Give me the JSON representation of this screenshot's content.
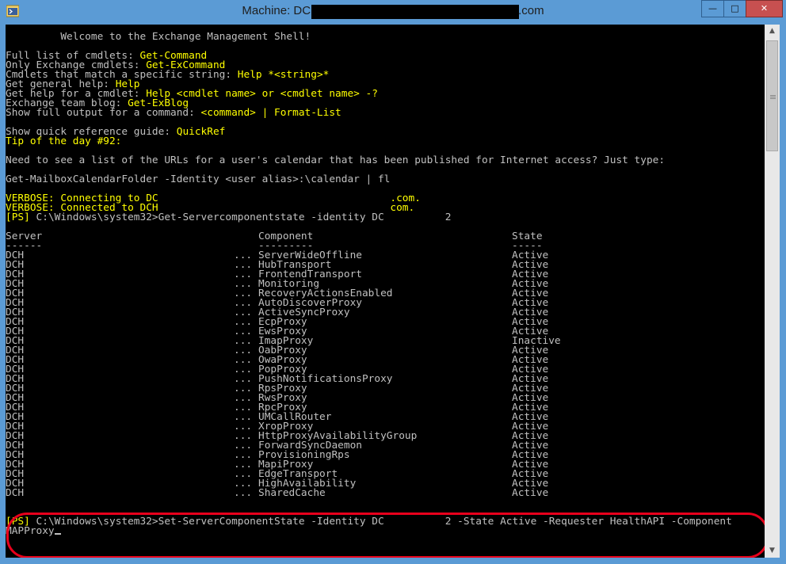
{
  "window": {
    "title_prefix": "Machine: DC",
    "title_suffix": ".com",
    "minimize": "—",
    "maximize": "□",
    "close": "✕"
  },
  "console": {
    "welcome": "         Welcome to the Exchange Management Shell!",
    "help_lines": [
      {
        "label": "Full list of cmdlets: ",
        "value": "Get-Command"
      },
      {
        "label": "Only Exchange cmdlets: ",
        "value": "Get-ExCommand"
      },
      {
        "label": "Cmdlets that match a specific string: ",
        "value": "Help *<string>*"
      },
      {
        "label": "Get general help: ",
        "value": "Help"
      },
      {
        "label": "Get help for a cmdlet: ",
        "value": "Help <cmdlet name> or <cmdlet name> -?"
      },
      {
        "label": "Exchange team blog: ",
        "value": "Get-ExBlog"
      },
      {
        "label": "Show full output for a command: ",
        "value": "<command> | Format-List"
      }
    ],
    "quickref_label": "Show quick reference guide: ",
    "quickref_value": "QuickRef",
    "tip": "Tip of the day #92:",
    "tip_text": "Need to see a list of the URLs for a user's calendar that has been published for Internet access? Just type:",
    "tip_command": "Get-MailboxCalendarFolder -Identity <user alias>:\\calendar | fl",
    "verbose1": "VERBOSE: Connecting to DC                                      .com.",
    "verbose2": "VERBOSE: Connected to DCH                                      com.",
    "prompt1": "[PS] C:\\Windows\\system32>Get-Servercomponentstate -identity DC          2",
    "headers": {
      "server": "Server",
      "component": "Component",
      "state": "State"
    },
    "underlines": {
      "server": "------",
      "component": "---------",
      "state": "-----"
    },
    "rows": [
      {
        "server": "DCH",
        "component": "ServerWideOffline",
        "state": "Active"
      },
      {
        "server": "DCH",
        "component": "HubTransport",
        "state": "Active"
      },
      {
        "server": "DCH",
        "component": "FrontendTransport",
        "state": "Active"
      },
      {
        "server": "DCH",
        "component": "Monitoring",
        "state": "Active"
      },
      {
        "server": "DCH",
        "component": "RecoveryActionsEnabled",
        "state": "Active"
      },
      {
        "server": "DCH",
        "component": "AutoDiscoverProxy",
        "state": "Active"
      },
      {
        "server": "DCH",
        "component": "ActiveSyncProxy",
        "state": "Active"
      },
      {
        "server": "DCH",
        "component": "EcpProxy",
        "state": "Active"
      },
      {
        "server": "DCH",
        "component": "EwsProxy",
        "state": "Active"
      },
      {
        "server": "DCH",
        "component": "ImapProxy",
        "state": "Inactive"
      },
      {
        "server": "DCH",
        "component": "OabProxy",
        "state": "Active"
      },
      {
        "server": "DCH",
        "component": "OwaProxy",
        "state": "Active"
      },
      {
        "server": "DCH",
        "component": "PopProxy",
        "state": "Active"
      },
      {
        "server": "DCH",
        "component": "PushNotificationsProxy",
        "state": "Active"
      },
      {
        "server": "DCH",
        "component": "RpsProxy",
        "state": "Active"
      },
      {
        "server": "DCH",
        "component": "RwsProxy",
        "state": "Active"
      },
      {
        "server": "DCH",
        "component": "RpcProxy",
        "state": "Active"
      },
      {
        "server": "DCH",
        "component": "UMCallRouter",
        "state": "Active"
      },
      {
        "server": "DCH",
        "component": "XropProxy",
        "state": "Active"
      },
      {
        "server": "DCH",
        "component": "HttpProxyAvailabilityGroup",
        "state": "Active"
      },
      {
        "server": "DCH",
        "component": "ForwardSyncDaemon",
        "state": "Active"
      },
      {
        "server": "DCH",
        "component": "ProvisioningRps",
        "state": "Active"
      },
      {
        "server": "DCH",
        "component": "MapiProxy",
        "state": "Active"
      },
      {
        "server": "DCH",
        "component": "EdgeTransport",
        "state": "Active"
      },
      {
        "server": "DCH",
        "component": "HighAvailability",
        "state": "Active"
      },
      {
        "server": "DCH",
        "component": "SharedCache",
        "state": "Active"
      }
    ],
    "ellipsis": "...",
    "prompt2_tag": "[PS]",
    "prompt2_rest": " C:\\Windows\\system32>Set-ServerComponentState -Identity DC          2 -State Active -Requester HealthAPI -Component",
    "prompt2_cont": "MAPProxy"
  },
  "colors": {
    "highlight_box": "#e8001c",
    "console_bg": "#000000",
    "accent_yellow": "#ffff00"
  }
}
